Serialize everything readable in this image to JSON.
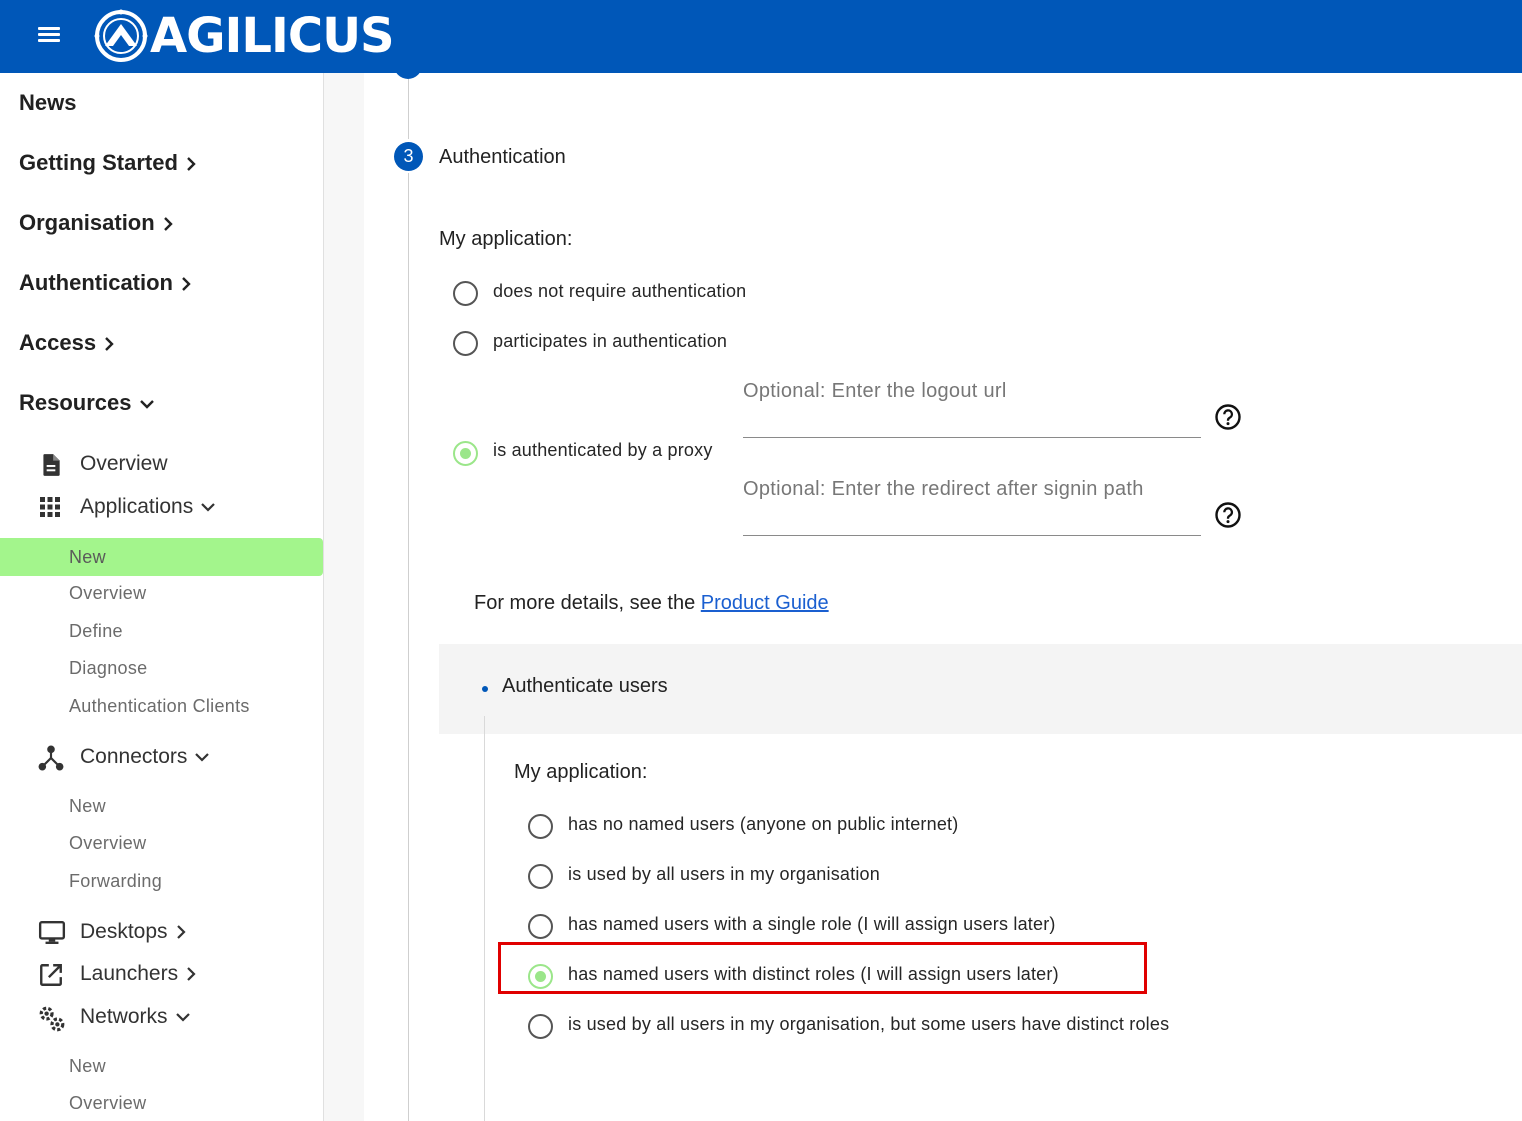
{
  "header": {
    "brand": "AGILICUS"
  },
  "sidebar": {
    "top_items": [
      {
        "label": "News"
      },
      {
        "label": "Getting Started"
      },
      {
        "label": "Organisation"
      },
      {
        "label": "Authentication"
      },
      {
        "label": "Access"
      },
      {
        "label": "Resources"
      }
    ],
    "resources": {
      "overview": "Overview",
      "applications": {
        "label": "Applications",
        "items": [
          "New",
          "Overview",
          "Define",
          "Diagnose",
          "Authentication Clients"
        ],
        "active": "New"
      },
      "connectors": {
        "label": "Connectors",
        "items": [
          "New",
          "Overview",
          "Forwarding"
        ]
      },
      "desktops": "Desktops",
      "launchers": "Launchers",
      "networks": {
        "label": "Networks",
        "items": [
          "New",
          "Overview"
        ]
      }
    }
  },
  "step": {
    "number": "3",
    "title": "Authentication"
  },
  "auth_section": {
    "heading": "My application:",
    "options": [
      {
        "label": "does not require authentication",
        "checked": false
      },
      {
        "label": "participates in authentication",
        "checked": false
      },
      {
        "label": "is authenticated by a proxy",
        "checked": true
      }
    ],
    "logout_placeholder": "Optional: Enter the logout url",
    "redirect_placeholder": "Optional: Enter the redirect after signin path",
    "details_prefix": "For more details, see the ",
    "details_link": "Product Guide"
  },
  "users_panel": {
    "title": "Authenticate users",
    "heading": "My application:",
    "options": [
      {
        "label": "has no named users (anyone on public internet)",
        "checked": false
      },
      {
        "label": "is used by all users in my organisation",
        "checked": false
      },
      {
        "label": "has named users with a single role (I will assign users later)",
        "checked": false
      },
      {
        "label": "has named users with distinct roles (I will assign users later)",
        "checked": true
      },
      {
        "label": "is used by all users in my organisation, but some users have distinct roles",
        "checked": false
      }
    ]
  },
  "colors": {
    "brand_blue": "#0057b8",
    "active_green": "#a3f58c",
    "radio_checked": "#9be68a",
    "highlight_red": "#e00000",
    "link_blue": "#1a5fd0"
  },
  "icons": [
    "menu-icon",
    "agilicus-logo-icon",
    "chevron-right-icon",
    "chevron-down-icon",
    "document-icon",
    "apps-grid-icon",
    "connector-icon",
    "monitor-icon",
    "launch-icon",
    "gears-icon",
    "help-circle-icon"
  ]
}
